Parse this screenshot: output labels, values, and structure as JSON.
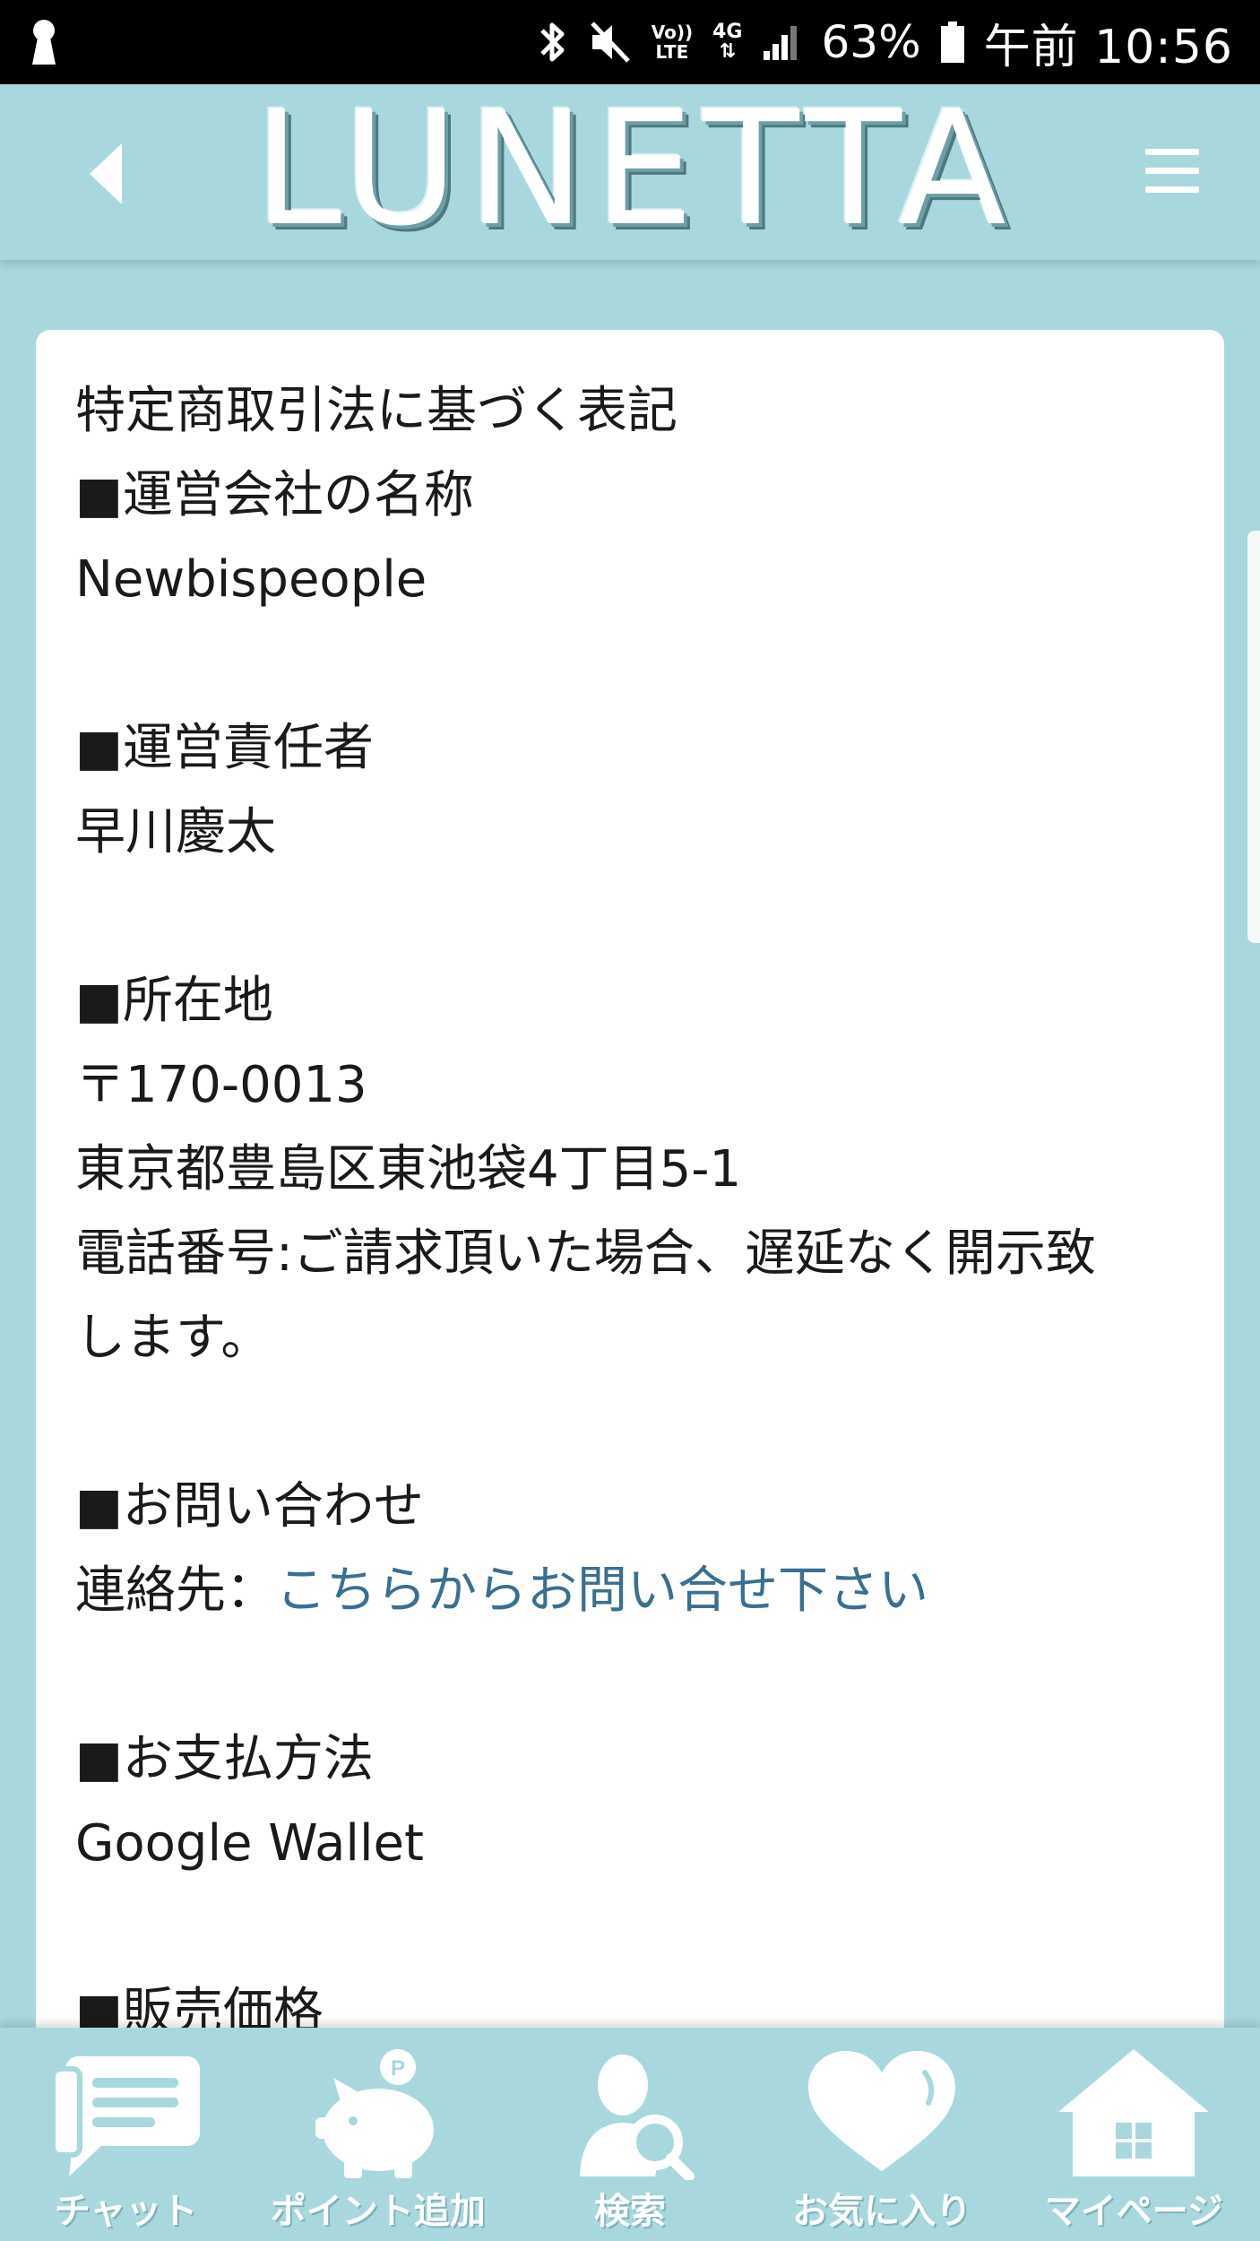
{
  "status_bar": {
    "lte_line1": "Vo))",
    "lte_line2": "LTE",
    "network_type": "4G",
    "battery_percent": "63%",
    "time": "午前 10:56"
  },
  "header": {
    "logo_text": "LUNETTA"
  },
  "content": {
    "lines": [
      "特定商取引法に基づく表記",
      "■運営会社の名称",
      "Newbispeople",
      "",
      "■運営責任者",
      "早川慶太",
      "",
      "■所在地",
      "〒170-0013",
      "東京都豊島区東池袋4丁目5-1",
      "電話番号:ご請求頂いた場合、遅延なく開示致",
      "します。",
      "",
      "■お問い合わせ"
    ],
    "contact_prefix": "連絡先：",
    "contact_link": "こちらからお問い合せ下さい",
    "lines_after": [
      "",
      "■お支払方法",
      "Google Wallet",
      "",
      "■販売価格"
    ]
  },
  "bottom_nav": {
    "items": [
      {
        "label": "チャット",
        "icon": "chat-icon"
      },
      {
        "label": "ポイント追加",
        "icon": "piggy-bank-icon"
      },
      {
        "label": "検索",
        "icon": "user-search-icon"
      },
      {
        "label": "お気に入り",
        "icon": "heart-icon"
      },
      {
        "label": "マイページ",
        "icon": "home-icon"
      }
    ]
  },
  "colors": {
    "theme": "#a8d8de",
    "link": "#3a6f93",
    "status_bar": "#000000"
  }
}
